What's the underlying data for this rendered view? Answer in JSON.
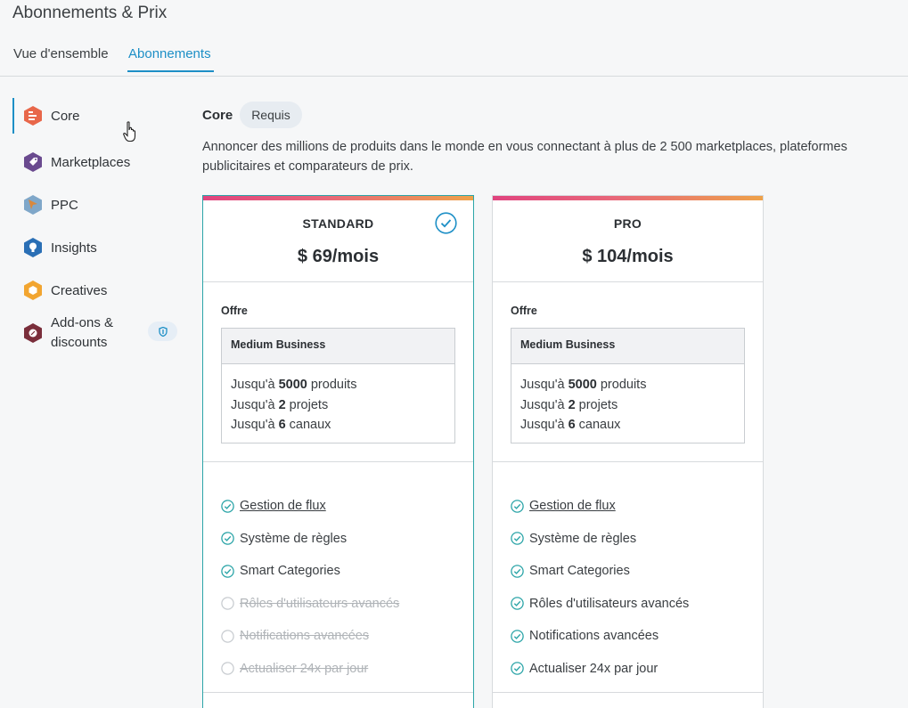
{
  "page": {
    "title": "Abonnements & Prix"
  },
  "tabs": [
    {
      "label": "Vue d'ensemble",
      "active": false
    },
    {
      "label": "Abonnements",
      "active": true
    }
  ],
  "sidebar": {
    "items": [
      {
        "label": "Core",
        "icon": "core-icon",
        "color": "#e8674a",
        "active": true
      },
      {
        "label": "Marketplaces",
        "icon": "tag-icon",
        "color": "#6a4a8f"
      },
      {
        "label": "PPC",
        "icon": "cursor-arrow-icon",
        "color": "#7fa7c9"
      },
      {
        "label": "Insights",
        "icon": "lightbulb-icon",
        "color": "#2a6fb5"
      },
      {
        "label": "Creatives",
        "icon": "box-icon",
        "color": "#f2a530"
      },
      {
        "label": "Add-ons & discounts",
        "icon": "percent-icon",
        "color": "#7a2e3b",
        "badge_icon": "shield-icon"
      }
    ]
  },
  "section": {
    "title": "Core",
    "badge": "Requis",
    "description": "Annoncer des millions de produits dans le monde en vous connectant à plus de 2 500 marketplaces, plateformes publicitaires et comparateurs de prix."
  },
  "plans": [
    {
      "name": "STANDARD",
      "price": "$ 69/mois",
      "selected": true,
      "offer_label": "Offre",
      "offer_tier": "Medium Business",
      "limits": {
        "products_prefix": "Jusqu'à ",
        "products_value": "5000",
        "products_suffix": " produits",
        "projects_prefix": "Jusqu'à ",
        "projects_value": "2",
        "projects_suffix": " projets",
        "channels_prefix": "Jusqu'à ",
        "channels_value": "6",
        "channels_suffix": " canaux"
      },
      "features": [
        {
          "label": "Gestion de flux",
          "included": true,
          "link": true
        },
        {
          "label": "Système de règles",
          "included": true
        },
        {
          "label": "Smart Categories",
          "included": true
        },
        {
          "label": "Rôles d'utilisateurs avancés",
          "included": false
        },
        {
          "label": "Notifications avancées",
          "included": false
        },
        {
          "label": "Actualiser 24x par jour",
          "included": false
        }
      ]
    },
    {
      "name": "PRO",
      "price": "$ 104/mois",
      "selected": false,
      "offer_label": "Offre",
      "offer_tier": "Medium Business",
      "limits": {
        "products_prefix": "Jusqu'à ",
        "products_value": "5000",
        "products_suffix": " produits",
        "projects_prefix": "Jusqu'à ",
        "projects_value": "2",
        "projects_suffix": " projets",
        "channels_prefix": "Jusqu'à ",
        "channels_value": "6",
        "channels_suffix": " canaux"
      },
      "features": [
        {
          "label": "Gestion de flux",
          "included": true,
          "link": true
        },
        {
          "label": "Système de règles",
          "included": true
        },
        {
          "label": "Smart Categories",
          "included": true
        },
        {
          "label": "Rôles d'utilisateurs avancés",
          "included": true
        },
        {
          "label": "Notifications avancées",
          "included": true
        },
        {
          "label": "Actualiser 24x par jour",
          "included": true
        }
      ]
    }
  ],
  "colors": {
    "accent": "#1d8fc6",
    "selected_border": "#2ca5a8",
    "check": "#2ca5a8"
  }
}
